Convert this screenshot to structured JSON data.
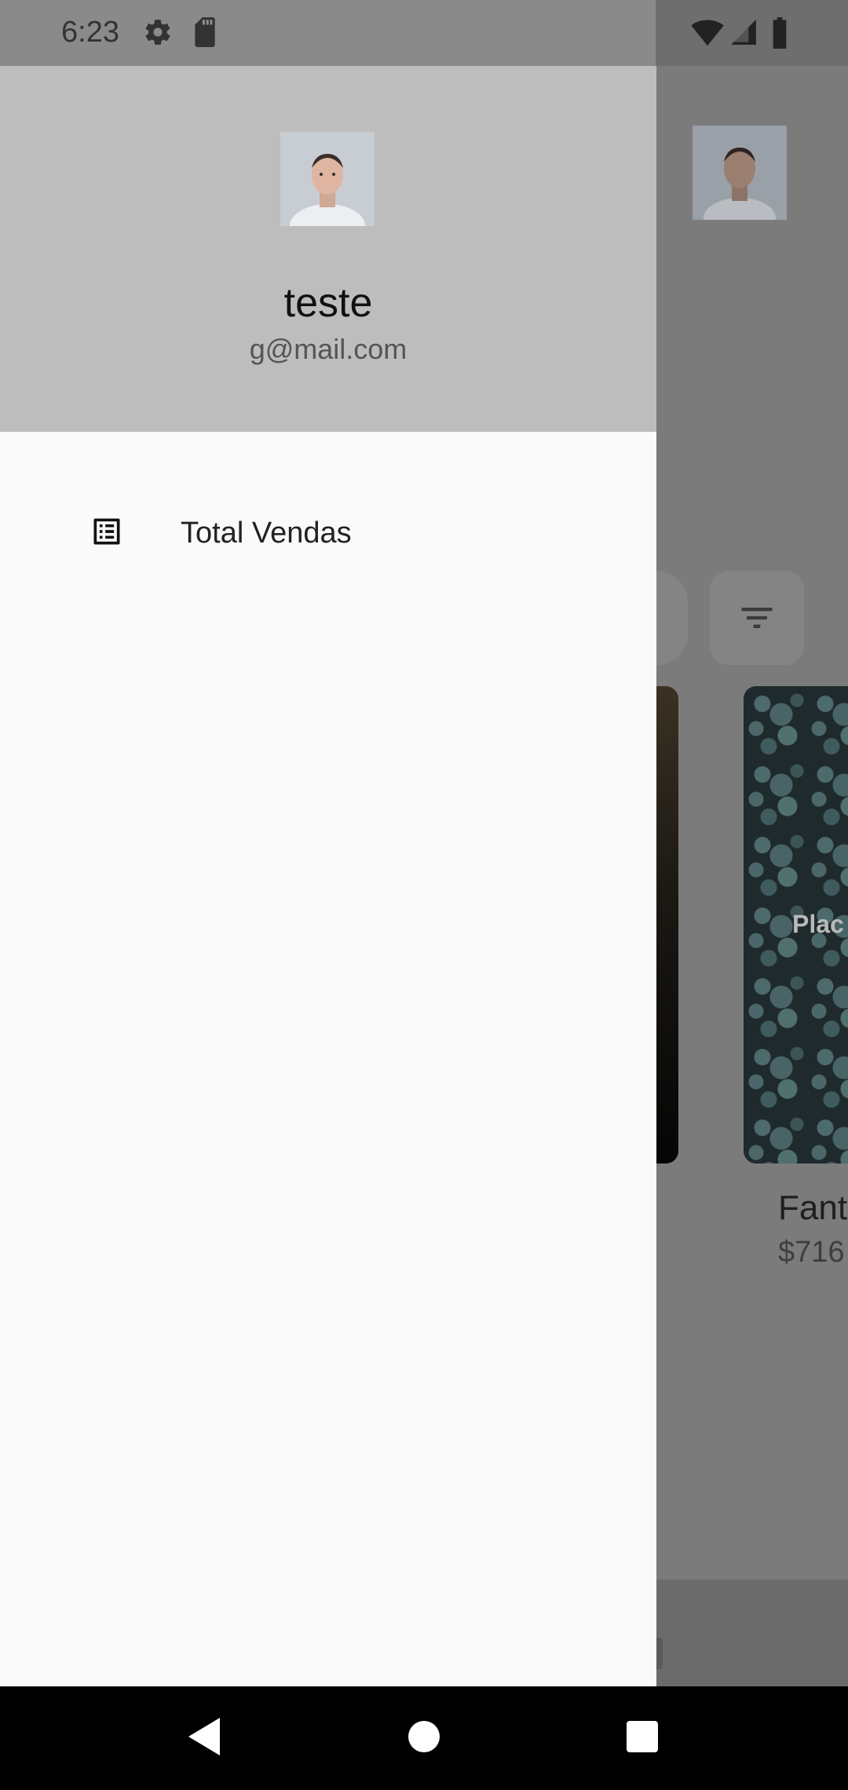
{
  "status_bar": {
    "time": "6:23",
    "icons_left": [
      "settings-icon",
      "sd-card-icon"
    ],
    "icons_right": [
      "wifi-icon",
      "signal-icon",
      "battery-icon"
    ]
  },
  "drawer": {
    "user_name": "teste",
    "user_email": "g@mail.com",
    "menu_items": [
      {
        "label": "Total Vendas",
        "icon": "list-alt-icon"
      }
    ]
  },
  "background_app": {
    "card_placeholder_text": "Plac",
    "card_title": "Fant",
    "card_price": "$716"
  },
  "nav_bar": {
    "buttons": [
      "back-icon",
      "home-icon",
      "recents-icon"
    ]
  },
  "colors": {
    "drawer_header_bg": "#bdbdbd",
    "drawer_bg": "#fafafa",
    "scrim": "#777777",
    "nav_bar_bg": "#000000"
  }
}
